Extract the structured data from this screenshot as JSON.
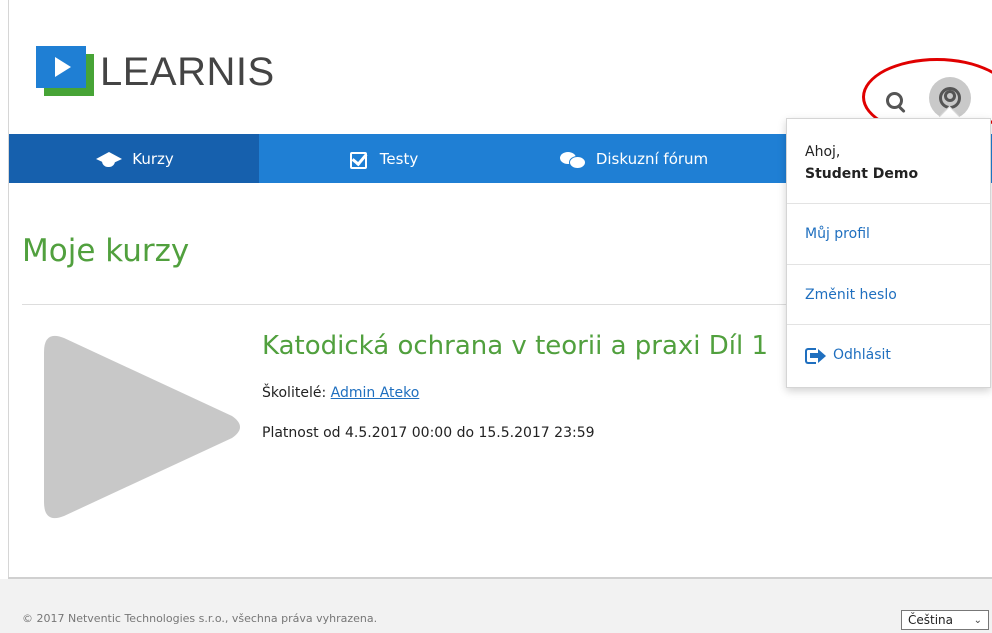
{
  "brand": {
    "name": "LEARNIS"
  },
  "header": {
    "search_icon": "search-icon",
    "account_icon": "user-circle-icon"
  },
  "nav": {
    "items": [
      {
        "label": "Kurzy",
        "icon": "graduation-cap-icon",
        "active": true
      },
      {
        "label": "Testy",
        "icon": "checkbox-icon",
        "active": false
      },
      {
        "label": "Diskuzní fórum",
        "icon": "chat-bubbles-icon",
        "active": false
      }
    ]
  },
  "main": {
    "title": "Moje kurzy",
    "course": {
      "title": "Katodická ochrana v teorii a praxi Díl 1",
      "trainers_label": "Školitelé:",
      "trainer_name": "Admin Ateko",
      "validity": "Platnost od 4.5.2017 00:00 do 15.5.2017 23:59"
    }
  },
  "user_menu": {
    "greeting": "Ahoj,",
    "user_name": "Student Demo",
    "profile": "Můj profil",
    "change_password": "Změnit heslo",
    "logout": "Odhlásit"
  },
  "footer": {
    "copyright": "© 2017 Netventic Technologies s.r.o., všechna práva vyhrazena.",
    "language": "Čeština"
  },
  "colors": {
    "nav_blue": "#1f7fd4",
    "nav_active": "#1660ad",
    "title_green": "#51a03e",
    "annotation_red": "#e00000"
  }
}
